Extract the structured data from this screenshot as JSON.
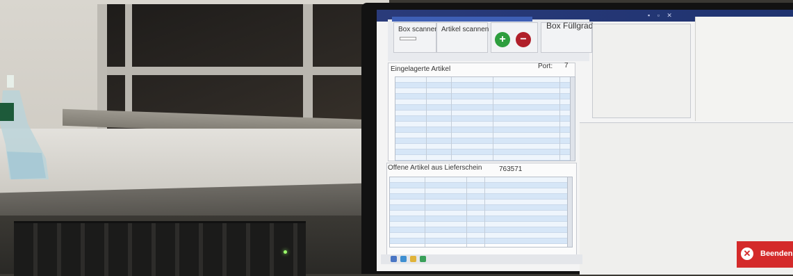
{
  "scene": {
    "description_free": true
  },
  "app": {
    "title": "",
    "toolbar": {
      "box_scan_label": "Box scannen",
      "article_scan_label": "Artikel scannen",
      "add_icon": "plus-icon",
      "remove_icon": "minus-icon",
      "fill_level_label": "Box Füllgrad"
    },
    "stored": {
      "title": "Eingelagerte Artikel",
      "port_label": "Port:",
      "port_value": "7"
    },
    "open": {
      "title": "Offene Artikel aus Lieferschein",
      "delivery_note": "763571"
    },
    "exit_label": "Beenden",
    "colors": {
      "exit_button": "#d42a2a",
      "add_button": "#2e9e3e",
      "remove_button": "#b01f2a",
      "grid_row": "#d6e6f7",
      "titlebar": "#2a3b7a"
    }
  }
}
